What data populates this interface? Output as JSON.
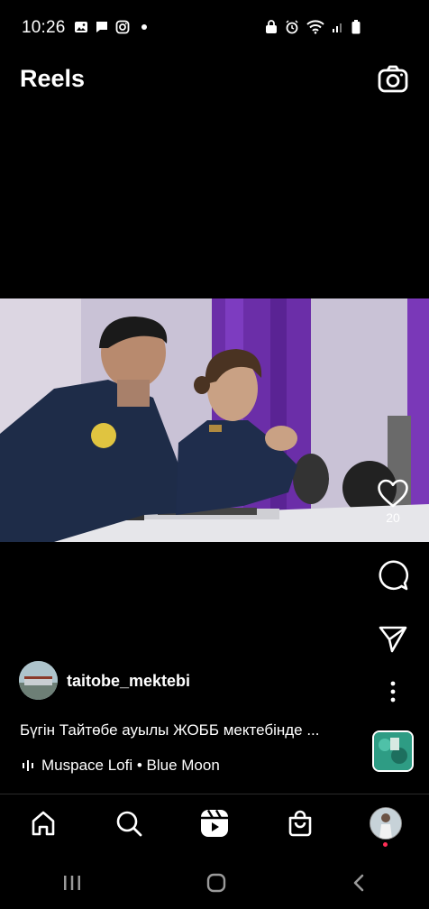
{
  "status_bar": {
    "time": "10:26",
    "left_icons": [
      "image-icon",
      "message-icon",
      "instagram-icon",
      "dot-icon"
    ],
    "right_icons": [
      "lock-icon",
      "alarm-icon",
      "wifi-icon",
      "signal-icon",
      "battery-icon"
    ]
  },
  "header": {
    "title": "Reels",
    "camera_icon": "camera-icon"
  },
  "reel": {
    "like_count": "20",
    "author": "taitobe_mektebi",
    "caption": "Бүгін Тайтөбе ауылы ЖОББ мектебінде ...",
    "audio": "Muspace Lofi • Blue Moon"
  },
  "bottom_nav": {
    "items": [
      "home-icon",
      "search-icon",
      "reels-icon",
      "shop-icon",
      "profile-avatar"
    ]
  },
  "system_nav": {
    "items": [
      "recents-icon",
      "home-button-icon",
      "back-icon"
    ]
  },
  "colors": {
    "background": "#000000",
    "text": "#ffffff",
    "notification_dot": "#ff2d55"
  }
}
